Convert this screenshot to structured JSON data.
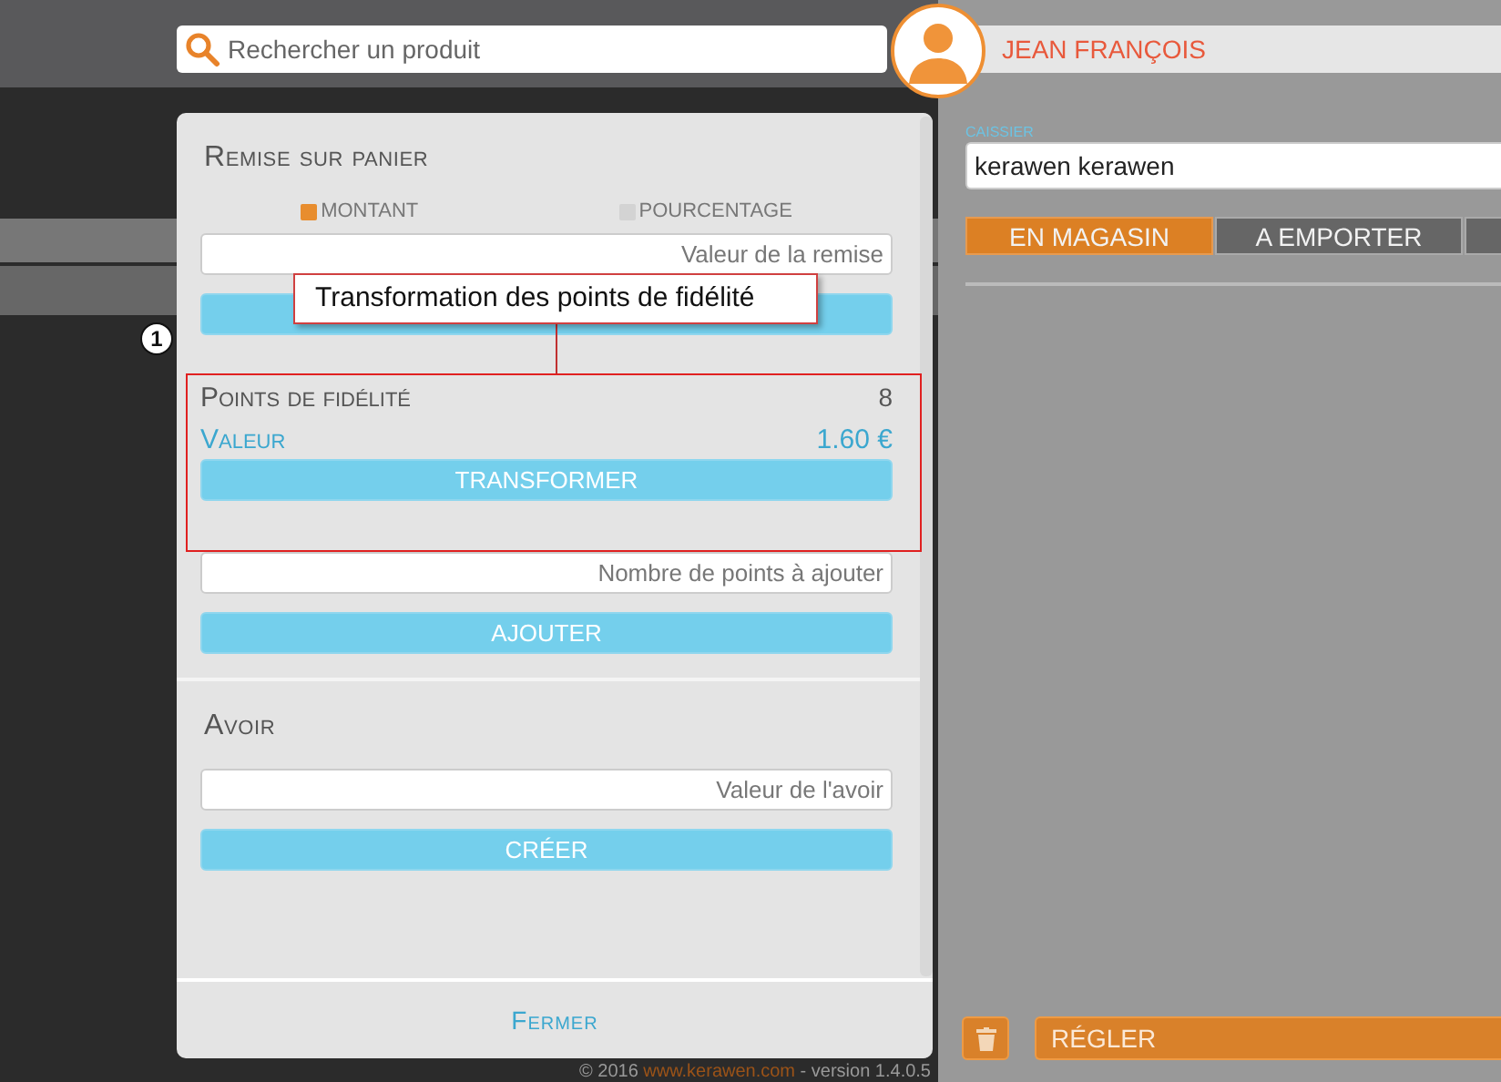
{
  "search": {
    "placeholder": "Rechercher un produit"
  },
  "customer": {
    "name": "JEAN FRANÇOIS"
  },
  "cashier": {
    "label": "CAISSIER",
    "value": "kerawen kerawen"
  },
  "order_tabs": [
    {
      "label": "EN MAGASIN",
      "selected": true
    },
    {
      "label": "A EMPORTER",
      "selected": false
    },
    {
      "selected": false
    }
  ],
  "pay_button": "RÉGLER",
  "dialog": {
    "discount": {
      "title": "Remise sur panier",
      "options": [
        {
          "label": "MONTANT",
          "selected": true
        },
        {
          "label": "POURCENTAGE",
          "selected": false
        }
      ],
      "placeholder": "Valeur de la remise"
    },
    "loyalty": {
      "title": "Points de fidélité",
      "points": "8",
      "value_label": "Valeur",
      "value": "1.60 €",
      "button": "TRANSFORMER",
      "add_placeholder": "Nombre de points à ajouter",
      "add_button": "AJOUTER"
    },
    "credit": {
      "title": "Avoir",
      "placeholder": "Valeur de l'avoir",
      "button": "CRÉER"
    },
    "close": "Fermer"
  },
  "callout": {
    "number": "1",
    "text": "Transformation des points de fidélité"
  },
  "footer": {
    "prefix": "© 2016 ",
    "link": "www.kerawen.com",
    "suffix": " - version 1.4.0.5"
  }
}
